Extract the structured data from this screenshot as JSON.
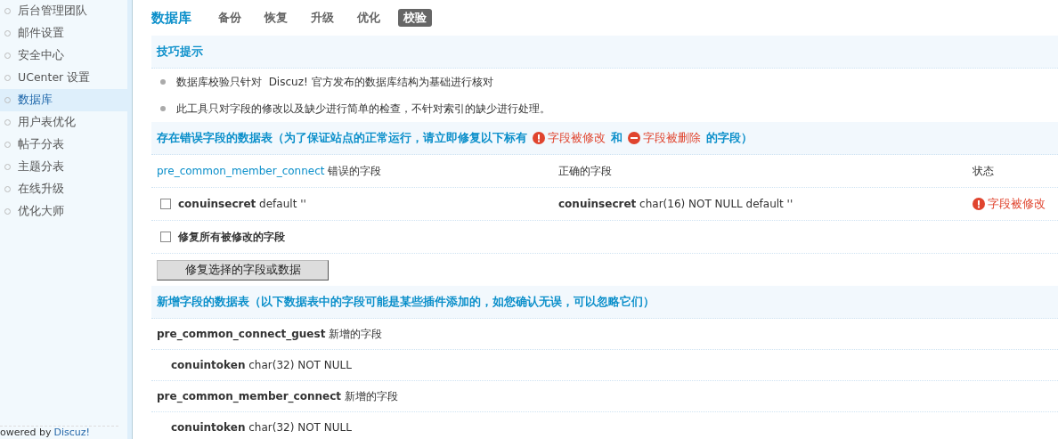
{
  "sidebar": {
    "items": [
      {
        "label": "后台管理团队",
        "selected": false
      },
      {
        "label": "邮件设置",
        "selected": false
      },
      {
        "label": "安全中心",
        "selected": false
      },
      {
        "label": "UCenter 设置",
        "selected": false
      },
      {
        "label": "数据库",
        "selected": true
      },
      {
        "label": "用户表优化",
        "selected": false
      },
      {
        "label": "帖子分表",
        "selected": false
      },
      {
        "label": "主题分表",
        "selected": false
      },
      {
        "label": "在线升级",
        "selected": false
      },
      {
        "label": "优化大师",
        "selected": false
      }
    ],
    "footer": {
      "text": "owered by",
      "link": "Discuz!"
    }
  },
  "header": {
    "title": "数据库",
    "tabs": [
      {
        "label": "备份",
        "selected": false
      },
      {
        "label": "恢复",
        "selected": false
      },
      {
        "label": "升级",
        "selected": false
      },
      {
        "label": "优化",
        "selected": false
      },
      {
        "label": "校验",
        "selected": true
      }
    ]
  },
  "tips": {
    "title": "技巧提示",
    "items": [
      "数据库校验只针对  Discuz! 官方发布的数据库结构为基础进行核对",
      "此工具只对字段的修改以及缺少进行简单的检查，不针对索引的缺少进行处理。"
    ]
  },
  "errors": {
    "title": [
      {
        "kind": "text",
        "text": "存在错误字段的数据表（为了保证站点的正常运行，请立即修复以下标有"
      },
      {
        "kind": "modified",
        "text": "字段被修改"
      },
      {
        "kind": "text",
        "text": "和"
      },
      {
        "kind": "deleted",
        "text": "字段被删除"
      },
      {
        "kind": "text",
        "text": "的字段）"
      }
    ],
    "table_name": "pre_common_member_connect",
    "columns": [
      "错误的字段",
      "正确的字段",
      "状态"
    ],
    "rows": [
      {
        "checked": false,
        "field": "conuinsecret",
        "wrong": "default ''",
        "correct_field": "conuinsecret",
        "correct": "char(16) NOT NULL default ''",
        "status": {
          "kind": "modified",
          "text": "字段被修改"
        }
      }
    ],
    "fix_all": {
      "label": "修复所有被修改的字段",
      "checked": false
    },
    "submit": "修复选择的字段或数据"
  },
  "added": {
    "title": "新增字段的数据表（以下数据表中的字段可能是某些插件添加的，如您确认无误，可以忽略它们）",
    "tables": [
      {
        "name": "pre_common_connect_guest",
        "note": "新增的字段",
        "fields": [
          {
            "name": "conuintoken",
            "type": "char(32) NOT NULL"
          }
        ]
      },
      {
        "name": "pre_common_member_connect",
        "note": "新增的字段",
        "fields": [
          {
            "name": "conuintoken",
            "type": "char(32) NOT NULL"
          }
        ]
      }
    ]
  }
}
